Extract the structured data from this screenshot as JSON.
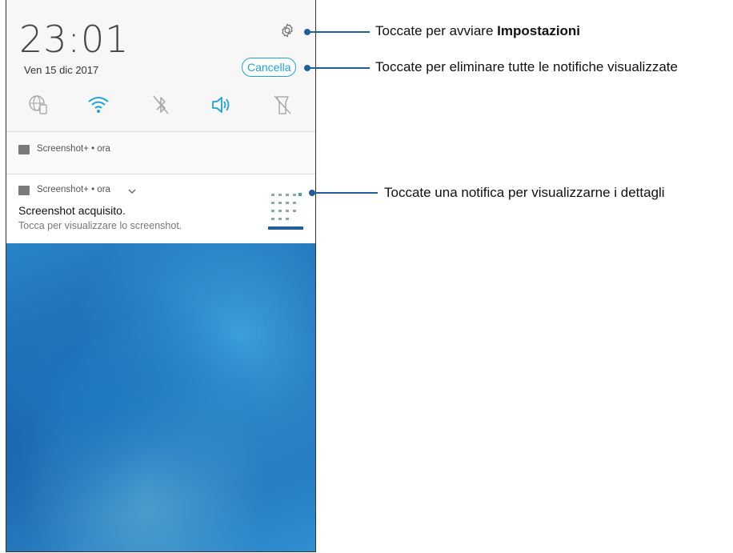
{
  "status": {
    "time": "23:01",
    "date": "Ven 15 dic 2017"
  },
  "quick_settings": {
    "clear_label": "Cancella",
    "tiles": [
      "globe-sim-icon",
      "wifi-icon",
      "bluetooth-off-icon",
      "volume-icon",
      "flashlight-off-icon"
    ]
  },
  "notifications": [
    {
      "app": "Screenshot+ • ora"
    },
    {
      "app": "Screenshot+ • ora",
      "title": "Screenshot acquisito.",
      "subtitle": "Tocca per visualizzare lo screenshot."
    }
  ],
  "callouts": {
    "settings_prefix": "Toccate per avviare ",
    "settings_bold": "Impostazioni",
    "clear": "Toccate per eliminare tutte le notifiche visualizzate",
    "notification": "Toccate una notifica per visualizzarne i dettagli"
  },
  "colors": {
    "accent": "#1da4d6",
    "callout": "#1f5f9e"
  }
}
